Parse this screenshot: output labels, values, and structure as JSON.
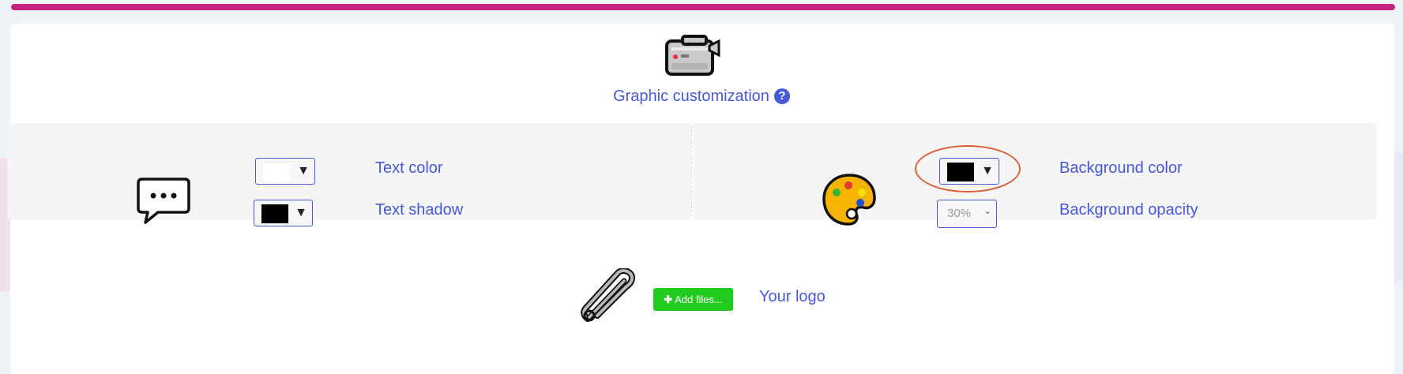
{
  "header": {
    "title": "Graphic customization",
    "help_icon": "question-circle-icon",
    "accent": "#c5217f",
    "link_color": "#4758d8"
  },
  "text_settings": {
    "icon": "speech-bubble-icon",
    "text_color": {
      "label": "Text color",
      "value": "#ffffff"
    },
    "text_shadow": {
      "label": "Text shadow",
      "value": "#000000"
    }
  },
  "background_settings": {
    "icon": "palette-icon",
    "background_color": {
      "label": "Background color",
      "value": "#000000"
    },
    "background_opacity": {
      "label": "Background opacity",
      "value": "30%"
    }
  },
  "logo": {
    "icon": "safety-pin-icon",
    "button_label": "Add files...",
    "label": "Your logo",
    "button_color": "#1fcc1f"
  }
}
